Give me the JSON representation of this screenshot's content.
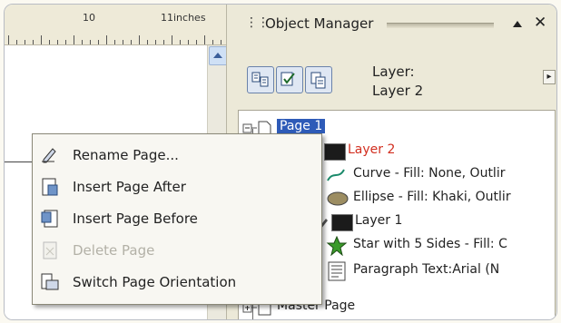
{
  "ruler": {
    "marks": [
      "10",
      "11"
    ],
    "unit_label": "inches"
  },
  "docker": {
    "title": "Object Manager",
    "layer_heading": "Layer:",
    "layer_name": "Layer 2",
    "toolbar_buttons": [
      "show-object-properties-icon",
      "edit-across-layers-icon",
      "layer-manager-view-icon"
    ]
  },
  "tree": {
    "page1": "Page 1",
    "layer2": "Layer 2",
    "curve": "Curve - Fill: None, Outlir",
    "ellipse": "Ellipse - Fill: Khaki, Outlir",
    "layer1": "Layer 1",
    "star": "Star with 5 Sides - Fill: C",
    "paragraph": "Paragraph Text:Arial (N",
    "master": "Master Page"
  },
  "context_menu": {
    "items": [
      {
        "label": "Rename Page...",
        "icon": "rename-page-icon",
        "enabled": true
      },
      {
        "label": "Insert Page After",
        "icon": "insert-page-after-icon",
        "enabled": true
      },
      {
        "label": "Insert Page Before",
        "icon": "insert-page-before-icon",
        "enabled": true
      },
      {
        "label": "Delete Page",
        "icon": "delete-page-icon",
        "enabled": false
      },
      {
        "label": "Switch Page Orientation",
        "icon": "switch-orientation-icon",
        "enabled": true
      }
    ]
  },
  "colors": {
    "selection": "#2e5bb8",
    "active_layer": "#d22f20",
    "docker_bg": "#ece9d8"
  }
}
